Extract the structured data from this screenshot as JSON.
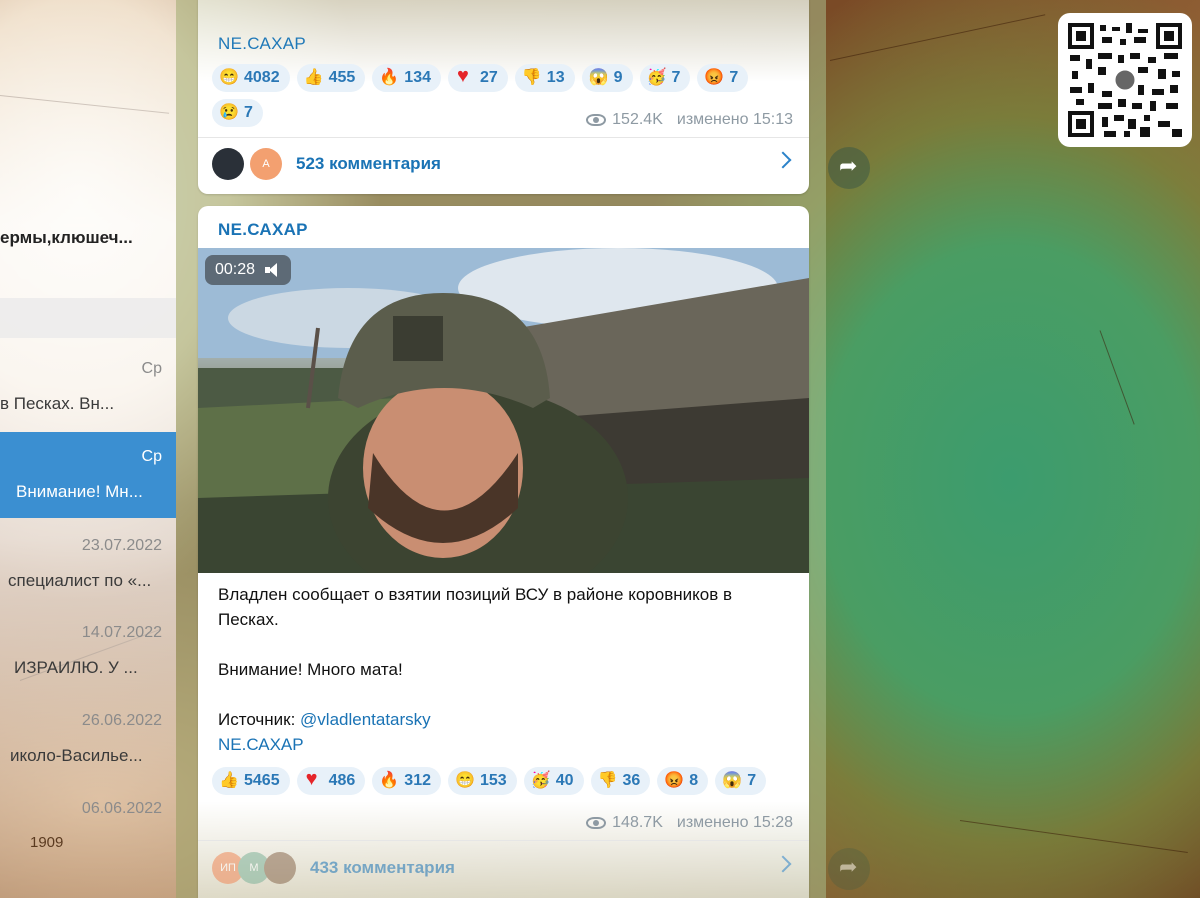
{
  "sidebar": {
    "items": [
      {
        "text": "ермы,клюшеч...",
        "date": ""
      },
      {
        "text": "в Песках.  Вн...",
        "date": "Ср"
      },
      {
        "text": "Внимание! Мн...",
        "date": "Ср",
        "active": true
      },
      {
        "text": "специалист по «...",
        "date": "23.07.2022"
      },
      {
        "text": "ИЗРАИЛЮ.  У ...",
        "date": "14.07.2022"
      },
      {
        "text": "иколо-Василье...",
        "date": "26.06.2022"
      },
      {
        "text": "1909",
        "date": "06.06.2022"
      }
    ]
  },
  "post1": {
    "signature": "NE.САХАР",
    "reactions": [
      {
        "icon": "grin-icon",
        "count": "4082"
      },
      {
        "icon": "thumbs-up-icon",
        "count": "455"
      },
      {
        "icon": "fire-icon",
        "count": "134"
      },
      {
        "icon": "heart-icon",
        "count": "27"
      },
      {
        "icon": "thumbs-down-icon",
        "count": "13"
      },
      {
        "icon": "scream-icon",
        "count": "9"
      },
      {
        "icon": "party-icon",
        "count": "7"
      },
      {
        "icon": "angry-icon",
        "count": "7"
      },
      {
        "icon": "cry-icon",
        "count": "7"
      }
    ],
    "views": "152.4K",
    "edited": "изменено 15:13",
    "comments_label": "523 комментария",
    "comment_avatar_letter": "А"
  },
  "post2": {
    "channel": "NE.САХАР",
    "video_time": "00:28",
    "text_line1": "Владлен сообщает о взятии позиций ВСУ в районе коровников в Песках.",
    "text_line2": "Внимание! Много мата!",
    "source_label": "Источник: ",
    "source_link": "@vladlentatarsky",
    "signature": "NE.САХАР",
    "reactions": [
      {
        "icon": "thumbs-up-icon",
        "count": "5465"
      },
      {
        "icon": "heart-icon",
        "count": "486"
      },
      {
        "icon": "fire-icon",
        "count": "312"
      },
      {
        "icon": "grin-icon",
        "count": "153"
      },
      {
        "icon": "party-icon",
        "count": "40"
      },
      {
        "icon": "thumbs-down-icon",
        "count": "36"
      },
      {
        "icon": "angry-icon",
        "count": "8"
      },
      {
        "icon": "scream-icon",
        "count": "7"
      }
    ],
    "views": "148.7K",
    "edited": "изменено 15:28",
    "comments_label": "433 комментария",
    "comment_avatar_letters": [
      "ИП",
      "М"
    ]
  },
  "colors": {
    "accent": "#1a73b5",
    "active_chat": "#3b8fd1",
    "reaction_bg": "#e8f1f9"
  }
}
